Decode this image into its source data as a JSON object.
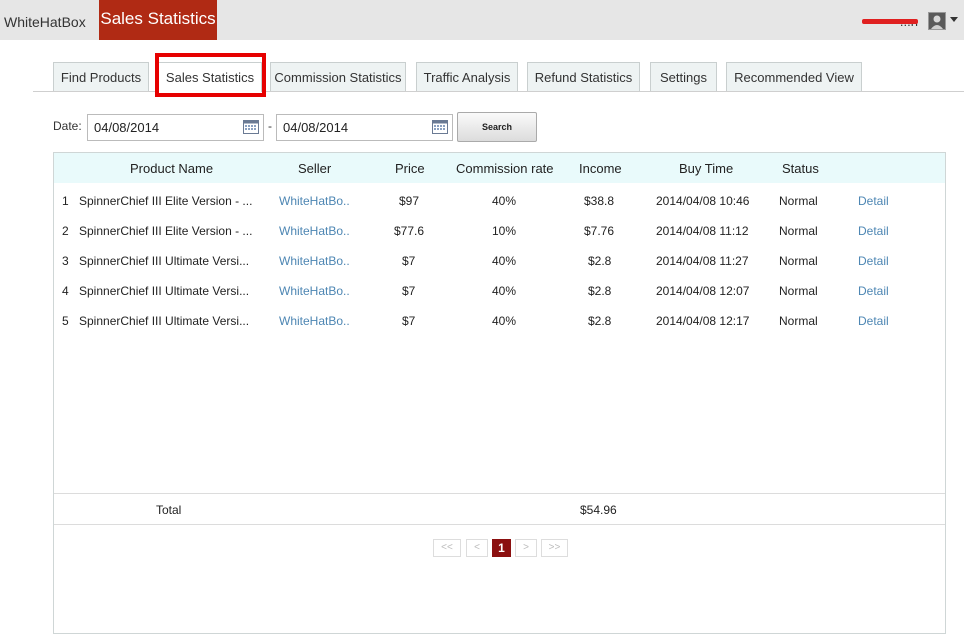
{
  "topbar": {
    "brand": "WhiteHatBox",
    "active_app": "Sales Statistics",
    "username": "...n"
  },
  "tabs": [
    {
      "label": "Find Products"
    },
    {
      "label": "Sales Statistics",
      "active": true
    },
    {
      "label": "Commission Statistics"
    },
    {
      "label": "Traffic Analysis"
    },
    {
      "label": "Refund Statistics"
    },
    {
      "label": "Settings"
    },
    {
      "label": "Recommended View"
    }
  ],
  "filter": {
    "date_label": "Date:",
    "start_date": "04/08/2014",
    "separator": "-",
    "end_date": "04/08/2014",
    "search_label": "Search"
  },
  "table": {
    "columns": [
      "Product Name",
      "Seller",
      "Price",
      "Commission rate",
      "Income",
      "Buy Time",
      "Status"
    ],
    "rows": [
      {
        "index": "1",
        "product": "SpinnerChief III Elite Version - ...",
        "seller": "WhiteHatBo..",
        "price": "$97",
        "rate": "40%",
        "income": "$38.8",
        "time": "2014/04/08 10:46",
        "status": "Normal",
        "action": "Detail"
      },
      {
        "index": "2",
        "product": "SpinnerChief III Elite Version - ...",
        "seller": "WhiteHatBo..",
        "price": "$77.6",
        "rate": "10%",
        "income": "$7.76",
        "time": "2014/04/08 11:12",
        "status": "Normal",
        "action": "Detail"
      },
      {
        "index": "3",
        "product": "SpinnerChief III Ultimate Versi...",
        "seller": "WhiteHatBo..",
        "price": "$7",
        "rate": "40%",
        "income": "$2.8",
        "time": "2014/04/08 11:27",
        "status": "Normal",
        "action": "Detail"
      },
      {
        "index": "4",
        "product": "SpinnerChief III Ultimate Versi...",
        "seller": "WhiteHatBo..",
        "price": "$7",
        "rate": "40%",
        "income": "$2.8",
        "time": "2014/04/08 12:07",
        "status": "Normal",
        "action": "Detail"
      },
      {
        "index": "5",
        "product": "SpinnerChief III Ultimate Versi...",
        "seller": "WhiteHatBo..",
        "price": "$7",
        "rate": "40%",
        "income": "$2.8",
        "time": "2014/04/08 12:17",
        "status": "Normal",
        "action": "Detail"
      }
    ],
    "total_label": "Total",
    "total_income": "$54.96"
  },
  "pagination": {
    "first": "<<",
    "prev": "<",
    "current": "1",
    "next": ">",
    "last": ">>"
  },
  "colors": {
    "brand_red": "#b02a14",
    "highlight_red": "#e60000",
    "link_blue": "#4d86b3",
    "header_bg": "#e9fafb",
    "page_active": "#8b1010"
  }
}
